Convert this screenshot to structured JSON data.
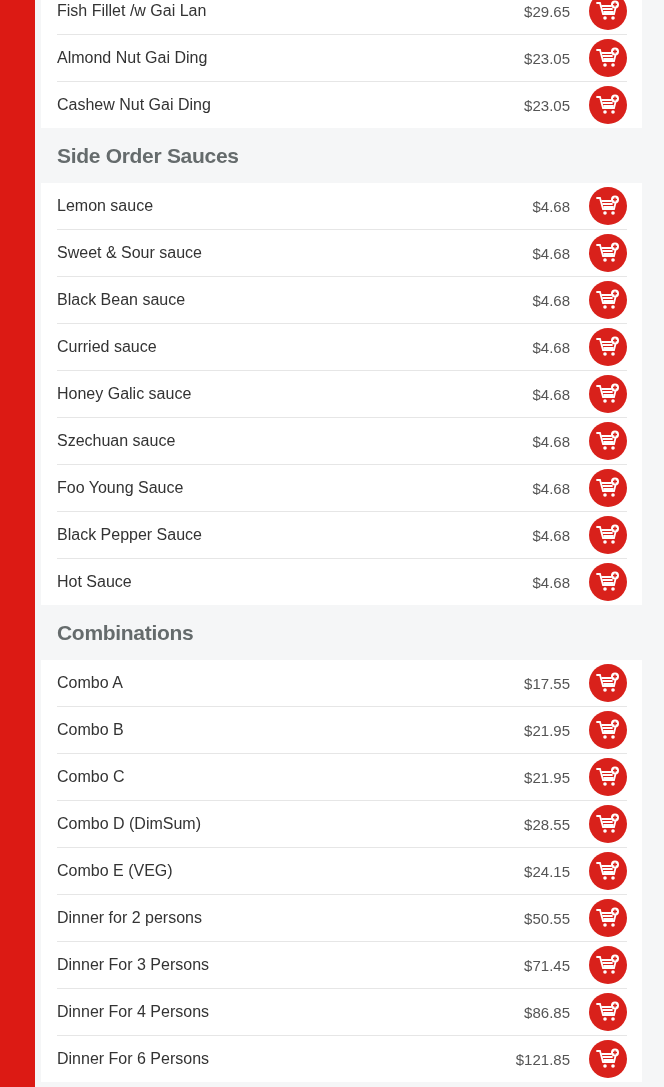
{
  "sections": [
    {
      "items": [
        {
          "name": "Fish Fillet /w Gai Lan",
          "price": "$29.65"
        },
        {
          "name": "Almond Nut Gai Ding",
          "price": "$23.05"
        },
        {
          "name": "Cashew Nut Gai Ding",
          "price": "$23.05"
        }
      ]
    },
    {
      "title": "Side Order Sauces",
      "items": [
        {
          "name": "Lemon sauce",
          "price": "$4.68"
        },
        {
          "name": "Sweet & Sour sauce",
          "price": "$4.68"
        },
        {
          "name": "Black Bean sauce",
          "price": "$4.68"
        },
        {
          "name": "Curried sauce",
          "price": "$4.68"
        },
        {
          "name": "Honey Galic sauce",
          "price": "$4.68"
        },
        {
          "name": "Szechuan sauce",
          "price": "$4.68"
        },
        {
          "name": "Foo Young Sauce",
          "price": "$4.68"
        },
        {
          "name": "Black Pepper Sauce",
          "price": "$4.68"
        },
        {
          "name": "Hot Sauce",
          "price": "$4.68"
        }
      ]
    },
    {
      "title": "Combinations",
      "items": [
        {
          "name": "Combo A",
          "price": "$17.55"
        },
        {
          "name": "Combo B",
          "price": "$21.95"
        },
        {
          "name": "Combo C",
          "price": "$21.95"
        },
        {
          "name": "Combo D (DimSum)",
          "price": "$28.55"
        },
        {
          "name": "Combo E (VEG)",
          "price": "$24.15"
        },
        {
          "name": "Dinner for 2 persons",
          "price": "$50.55"
        },
        {
          "name": "Dinner For 3 Persons",
          "price": "$71.45"
        },
        {
          "name": "Dinner For 4 Persons",
          "price": "$86.85"
        },
        {
          "name": "Dinner For 6 Persons",
          "price": "$121.85"
        }
      ]
    }
  ]
}
